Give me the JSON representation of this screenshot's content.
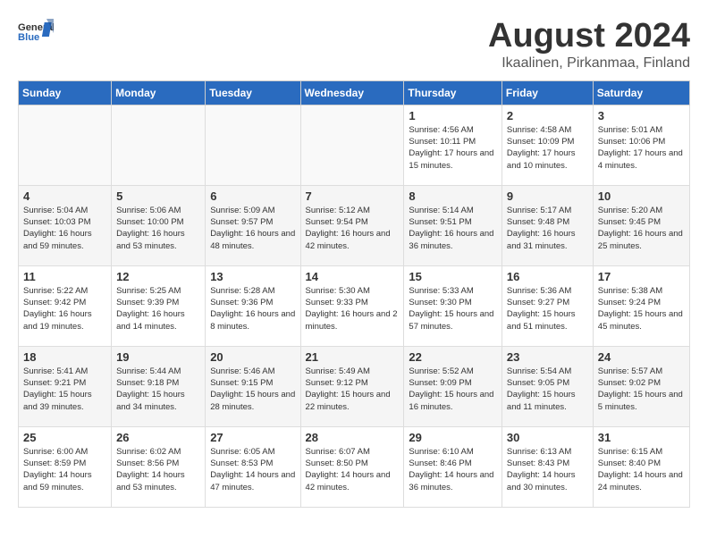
{
  "header": {
    "logo_general": "General",
    "logo_blue": "Blue",
    "title": "August 2024",
    "subtitle": "Ikaalinen, Pirkanmaa, Finland"
  },
  "calendar": {
    "days_of_week": [
      "Sunday",
      "Monday",
      "Tuesday",
      "Wednesday",
      "Thursday",
      "Friday",
      "Saturday"
    ],
    "weeks": [
      [
        {
          "day": "",
          "empty": true
        },
        {
          "day": "",
          "empty": true
        },
        {
          "day": "",
          "empty": true
        },
        {
          "day": "",
          "empty": true
        },
        {
          "day": "1",
          "sunrise": "Sunrise: 4:56 AM",
          "sunset": "Sunset: 10:11 PM",
          "daylight": "Daylight: 17 hours and 15 minutes."
        },
        {
          "day": "2",
          "sunrise": "Sunrise: 4:58 AM",
          "sunset": "Sunset: 10:09 PM",
          "daylight": "Daylight: 17 hours and 10 minutes."
        },
        {
          "day": "3",
          "sunrise": "Sunrise: 5:01 AM",
          "sunset": "Sunset: 10:06 PM",
          "daylight": "Daylight: 17 hours and 4 minutes."
        }
      ],
      [
        {
          "day": "4",
          "sunrise": "Sunrise: 5:04 AM",
          "sunset": "Sunset: 10:03 PM",
          "daylight": "Daylight: 16 hours and 59 minutes."
        },
        {
          "day": "5",
          "sunrise": "Sunrise: 5:06 AM",
          "sunset": "Sunset: 10:00 PM",
          "daylight": "Daylight: 16 hours and 53 minutes."
        },
        {
          "day": "6",
          "sunrise": "Sunrise: 5:09 AM",
          "sunset": "Sunset: 9:57 PM",
          "daylight": "Daylight: 16 hours and 48 minutes."
        },
        {
          "day": "7",
          "sunrise": "Sunrise: 5:12 AM",
          "sunset": "Sunset: 9:54 PM",
          "daylight": "Daylight: 16 hours and 42 minutes."
        },
        {
          "day": "8",
          "sunrise": "Sunrise: 5:14 AM",
          "sunset": "Sunset: 9:51 PM",
          "daylight": "Daylight: 16 hours and 36 minutes."
        },
        {
          "day": "9",
          "sunrise": "Sunrise: 5:17 AM",
          "sunset": "Sunset: 9:48 PM",
          "daylight": "Daylight: 16 hours and 31 minutes."
        },
        {
          "day": "10",
          "sunrise": "Sunrise: 5:20 AM",
          "sunset": "Sunset: 9:45 PM",
          "daylight": "Daylight: 16 hours and 25 minutes."
        }
      ],
      [
        {
          "day": "11",
          "sunrise": "Sunrise: 5:22 AM",
          "sunset": "Sunset: 9:42 PM",
          "daylight": "Daylight: 16 hours and 19 minutes."
        },
        {
          "day": "12",
          "sunrise": "Sunrise: 5:25 AM",
          "sunset": "Sunset: 9:39 PM",
          "daylight": "Daylight: 16 hours and 14 minutes."
        },
        {
          "day": "13",
          "sunrise": "Sunrise: 5:28 AM",
          "sunset": "Sunset: 9:36 PM",
          "daylight": "Daylight: 16 hours and 8 minutes."
        },
        {
          "day": "14",
          "sunrise": "Sunrise: 5:30 AM",
          "sunset": "Sunset: 9:33 PM",
          "daylight": "Daylight: 16 hours and 2 minutes."
        },
        {
          "day": "15",
          "sunrise": "Sunrise: 5:33 AM",
          "sunset": "Sunset: 9:30 PM",
          "daylight": "Daylight: 15 hours and 57 minutes."
        },
        {
          "day": "16",
          "sunrise": "Sunrise: 5:36 AM",
          "sunset": "Sunset: 9:27 PM",
          "daylight": "Daylight: 15 hours and 51 minutes."
        },
        {
          "day": "17",
          "sunrise": "Sunrise: 5:38 AM",
          "sunset": "Sunset: 9:24 PM",
          "daylight": "Daylight: 15 hours and 45 minutes."
        }
      ],
      [
        {
          "day": "18",
          "sunrise": "Sunrise: 5:41 AM",
          "sunset": "Sunset: 9:21 PM",
          "daylight": "Daylight: 15 hours and 39 minutes."
        },
        {
          "day": "19",
          "sunrise": "Sunrise: 5:44 AM",
          "sunset": "Sunset: 9:18 PM",
          "daylight": "Daylight: 15 hours and 34 minutes."
        },
        {
          "day": "20",
          "sunrise": "Sunrise: 5:46 AM",
          "sunset": "Sunset: 9:15 PM",
          "daylight": "Daylight: 15 hours and 28 minutes."
        },
        {
          "day": "21",
          "sunrise": "Sunrise: 5:49 AM",
          "sunset": "Sunset: 9:12 PM",
          "daylight": "Daylight: 15 hours and 22 minutes."
        },
        {
          "day": "22",
          "sunrise": "Sunrise: 5:52 AM",
          "sunset": "Sunset: 9:09 PM",
          "daylight": "Daylight: 15 hours and 16 minutes."
        },
        {
          "day": "23",
          "sunrise": "Sunrise: 5:54 AM",
          "sunset": "Sunset: 9:05 PM",
          "daylight": "Daylight: 15 hours and 11 minutes."
        },
        {
          "day": "24",
          "sunrise": "Sunrise: 5:57 AM",
          "sunset": "Sunset: 9:02 PM",
          "daylight": "Daylight: 15 hours and 5 minutes."
        }
      ],
      [
        {
          "day": "25",
          "sunrise": "Sunrise: 6:00 AM",
          "sunset": "Sunset: 8:59 PM",
          "daylight": "Daylight: 14 hours and 59 minutes."
        },
        {
          "day": "26",
          "sunrise": "Sunrise: 6:02 AM",
          "sunset": "Sunset: 8:56 PM",
          "daylight": "Daylight: 14 hours and 53 minutes."
        },
        {
          "day": "27",
          "sunrise": "Sunrise: 6:05 AM",
          "sunset": "Sunset: 8:53 PM",
          "daylight": "Daylight: 14 hours and 47 minutes."
        },
        {
          "day": "28",
          "sunrise": "Sunrise: 6:07 AM",
          "sunset": "Sunset: 8:50 PM",
          "daylight": "Daylight: 14 hours and 42 minutes."
        },
        {
          "day": "29",
          "sunrise": "Sunrise: 6:10 AM",
          "sunset": "Sunset: 8:46 PM",
          "daylight": "Daylight: 14 hours and 36 minutes."
        },
        {
          "day": "30",
          "sunrise": "Sunrise: 6:13 AM",
          "sunset": "Sunset: 8:43 PM",
          "daylight": "Daylight: 14 hours and 30 minutes."
        },
        {
          "day": "31",
          "sunrise": "Sunrise: 6:15 AM",
          "sunset": "Sunset: 8:40 PM",
          "daylight": "Daylight: 14 hours and 24 minutes."
        }
      ]
    ]
  }
}
